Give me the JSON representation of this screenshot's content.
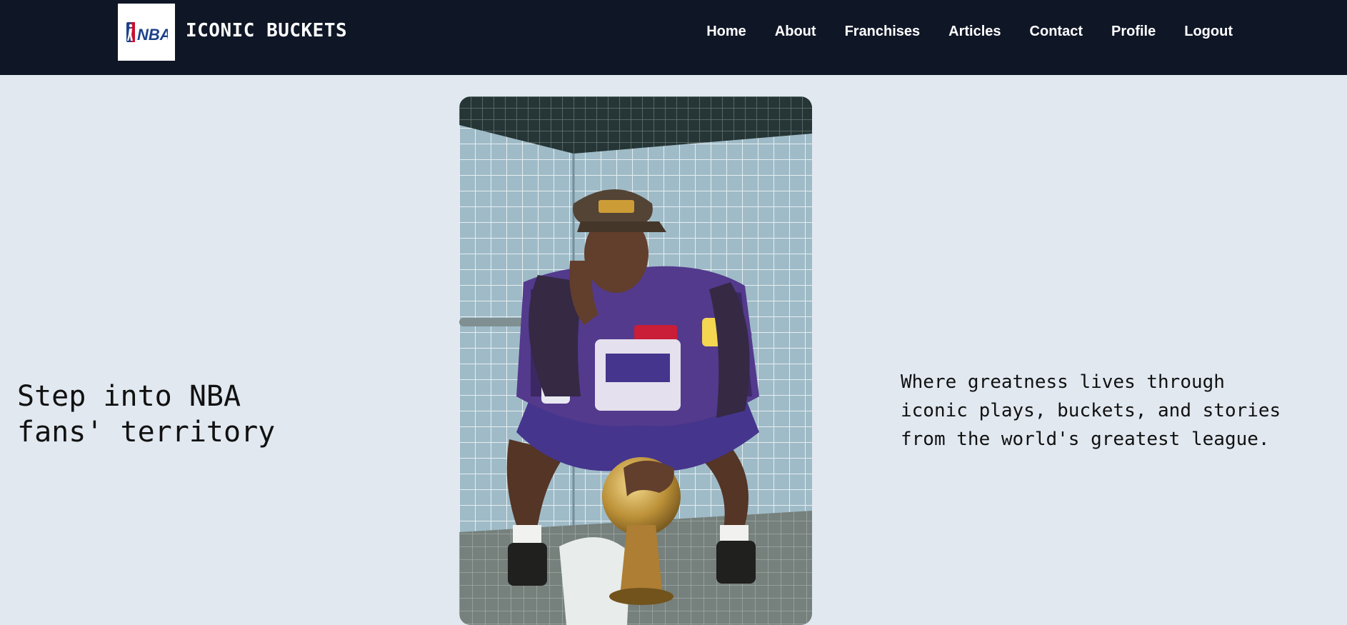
{
  "header": {
    "logo_text": "NBA",
    "brand": "ICONIC BUCKETS",
    "nav": [
      {
        "label": "Home"
      },
      {
        "label": "About"
      },
      {
        "label": "Franchises"
      },
      {
        "label": "Articles"
      },
      {
        "label": "Contact"
      },
      {
        "label": "Profile"
      },
      {
        "label": "Logout"
      }
    ]
  },
  "hero": {
    "heading": "Step into NBA fans' territory",
    "tagline": "Where greatness lives through iconic plays, buckets, and stories from the world's greatest league.",
    "image_subject": "player-with-trophy-photo"
  },
  "colors": {
    "nav_bg": "#0f1626",
    "page_bg": "#e1e8f0",
    "logo_blue": "#1d428a",
    "logo_red": "#c8102e"
  }
}
